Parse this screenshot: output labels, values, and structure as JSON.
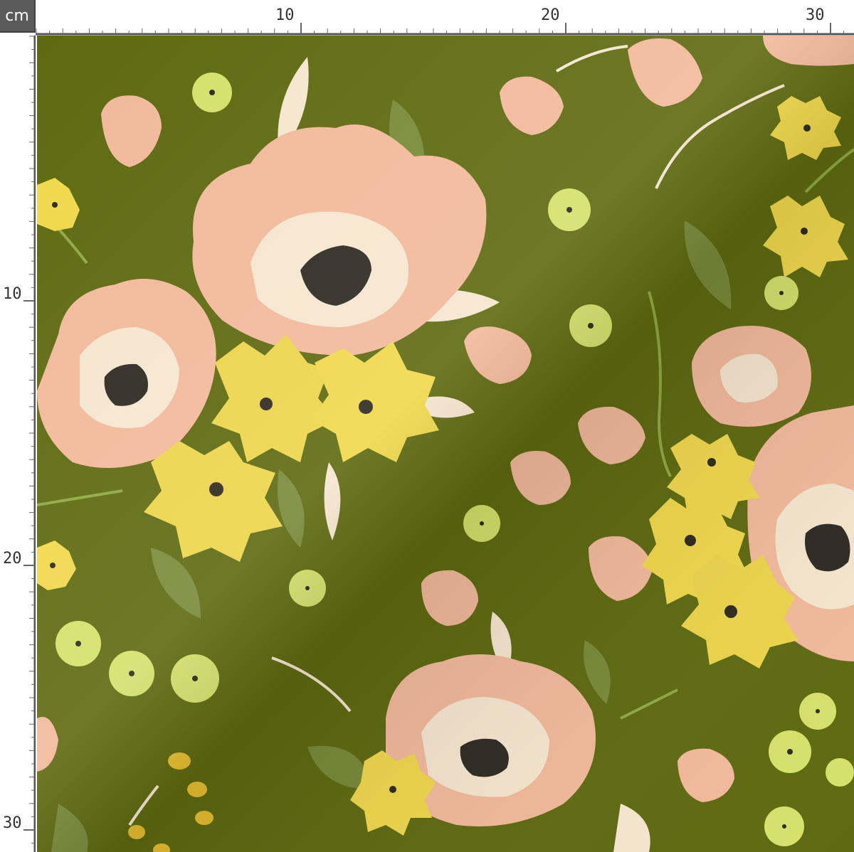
{
  "ruler": {
    "unit": "cm",
    "top_labels": [
      "10",
      "20",
      "30"
    ],
    "left_labels": [
      "10",
      "20",
      "30"
    ]
  },
  "fabric": {
    "background_color": "#5e6a10",
    "petal_peach": "#f2b99a",
    "petal_cream": "#f6e6cf",
    "daisy_yellow": "#f0d84a",
    "small_lime": "#d6e06a",
    "leaf_green": "#7d8f40",
    "center_dark": "#2e2a22"
  }
}
